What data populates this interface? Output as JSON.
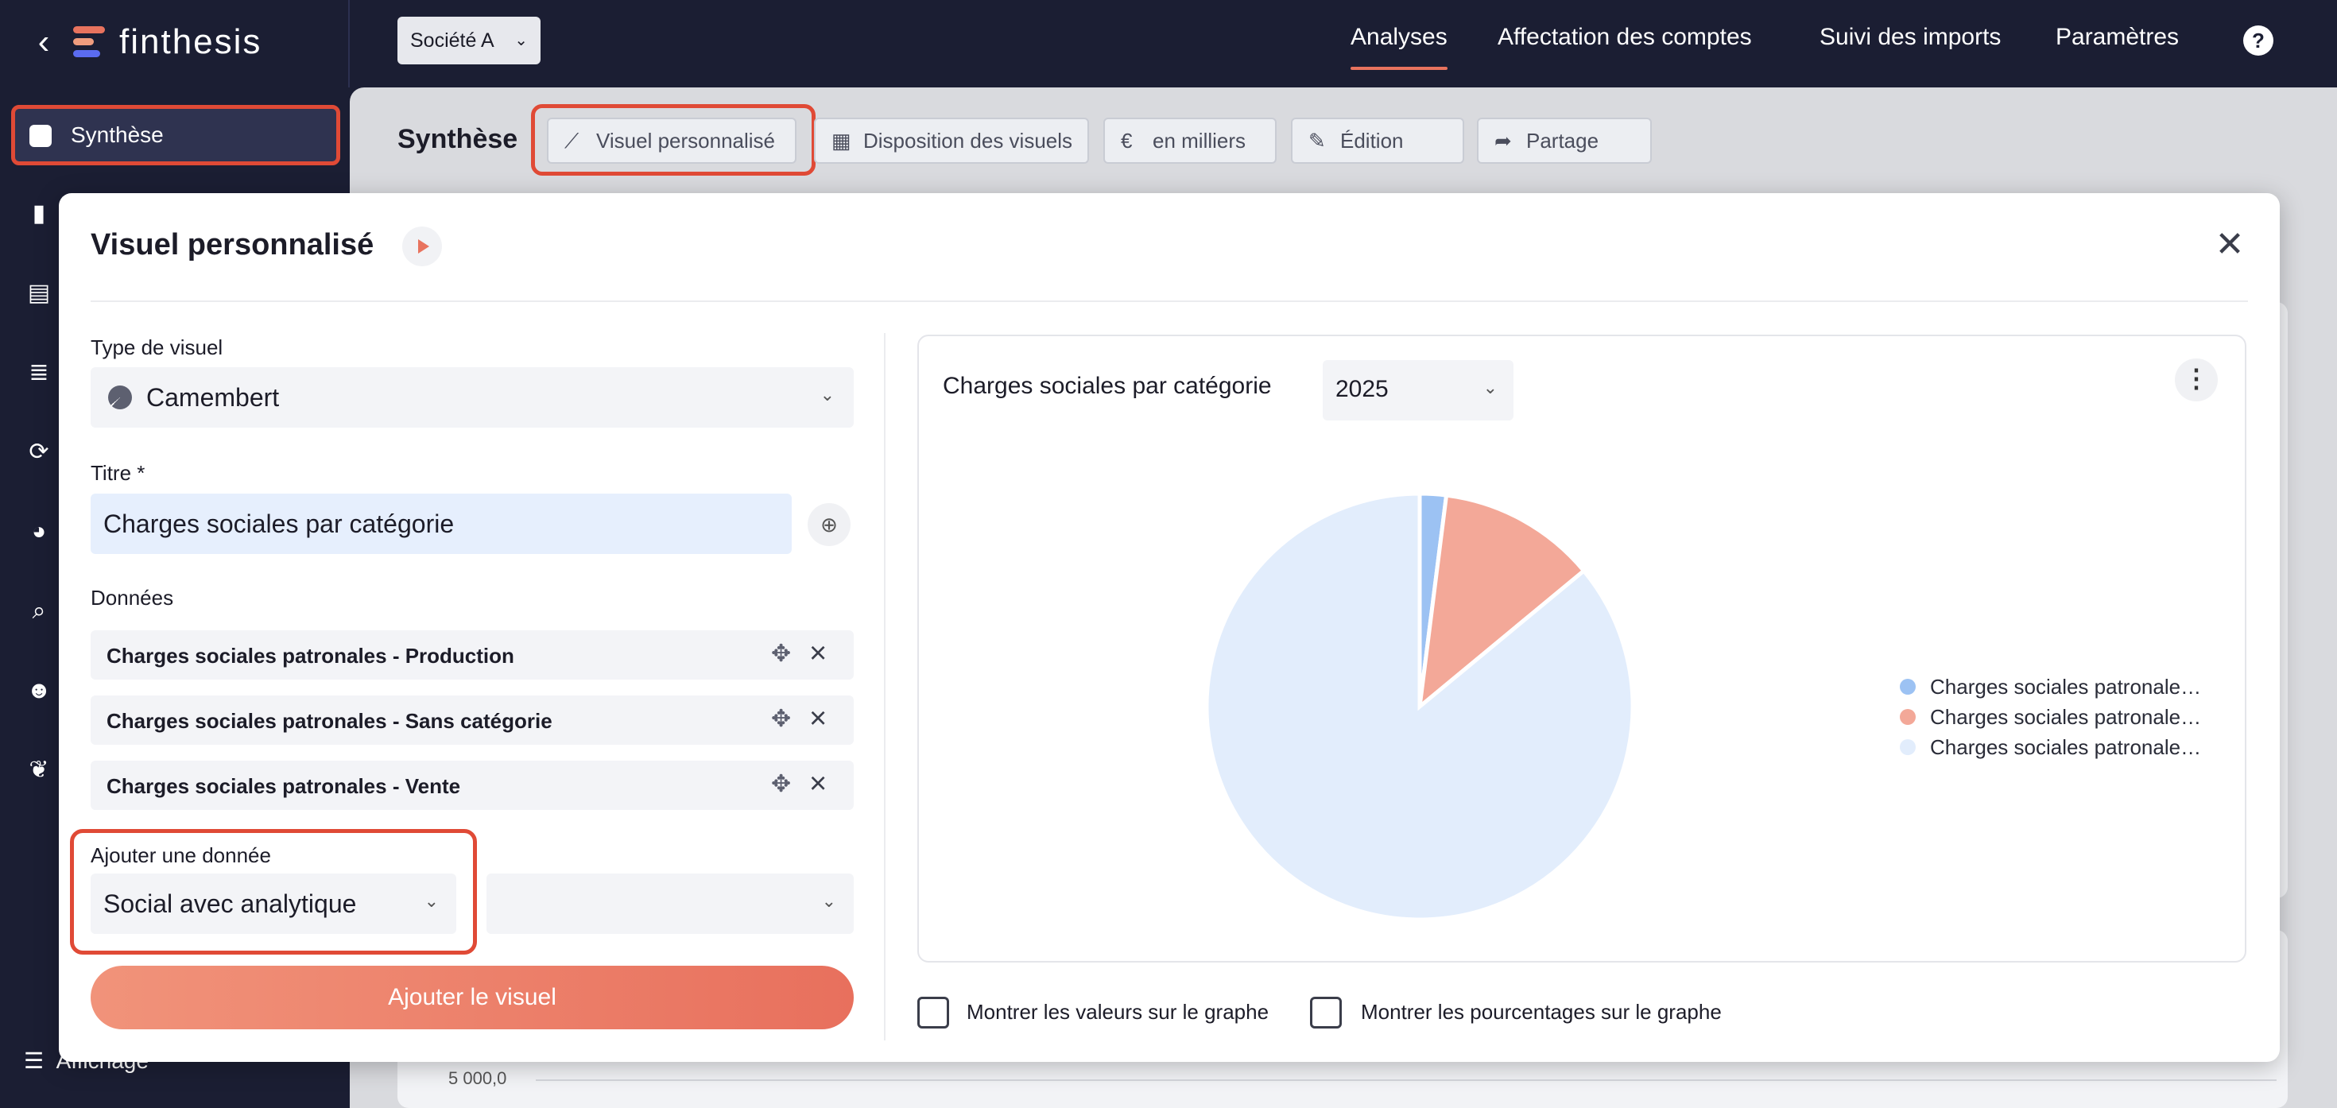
{
  "app": {
    "name": "finthesis"
  },
  "topbar": {
    "company": "Société A",
    "nav": [
      "Analyses",
      "Affectation des comptes",
      "Suivi des imports",
      "Paramètres"
    ],
    "help": "?"
  },
  "sidebar": {
    "active_label": "Synthèse",
    "bottom_label": "Affichage"
  },
  "page": {
    "title": "Synthèse",
    "toolbar": [
      "Visuel personnalisé",
      "Disposition des visuels",
      "en milliers",
      "Édition",
      "Partage"
    ],
    "background_axis_tick": "5 000,0"
  },
  "modal": {
    "title": "Visuel personnalisé",
    "type_label": "Type de visuel",
    "type_value": "Camembert",
    "title_label": "Titre *",
    "title_value": "Charges sociales par catégorie",
    "data_label": "Données",
    "data_items": [
      "Charges sociales patronales - Production",
      "Charges sociales patronales - Sans catégorie",
      "Charges sociales patronales - Vente"
    ],
    "add_label": "Ajouter une donnée",
    "add_source_value": "Social avec analytique",
    "add_item_value": "",
    "add_button": "Ajouter le visuel",
    "show_values": "Montrer les valeurs sur le graphe",
    "show_percentages": "Montrer les pourcentages sur le graphe"
  },
  "chart_data": {
    "type": "pie",
    "title": "Charges sociales par catégorie",
    "year": "2025",
    "legend_position": "right",
    "labels": [
      "Charges sociales patronale…",
      "Charges sociales patronale…",
      "Charges sociales patronale…"
    ],
    "values": [
      2,
      12,
      86
    ],
    "colors": [
      "#9cc2f3",
      "#f3a898",
      "#e2edfc"
    ]
  },
  "colors": {
    "brand_dark": "#1b1e33",
    "accent": "#e8735e",
    "highlight": "#e04a36"
  }
}
